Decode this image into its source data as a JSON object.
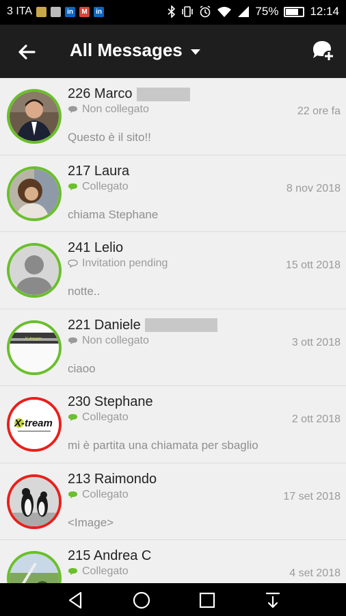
{
  "status_bar": {
    "carrier": "3 ITA",
    "battery": "75%",
    "battery_level": 0.75,
    "time": "12:14"
  },
  "app_bar": {
    "title": "All Messages"
  },
  "conversations": [
    {
      "name": "226 Marco",
      "status": "Non collegato",
      "date": "22 ore fa",
      "message": "Questo è il sito!!",
      "online": false,
      "avatar": "marco-photo",
      "ring": "#6abf2b"
    },
    {
      "name": "217 Laura",
      "status": "Collegato",
      "date": "8 nov 2018",
      "message": "chiama Stephane",
      "online": true,
      "avatar": "laura-photo",
      "ring": "#6abf2b"
    },
    {
      "name": "241 Lelio",
      "status": "Invitation pending",
      "date": "15 ott 2018",
      "message": "notte..",
      "online": false,
      "avatar": "default-person",
      "ring": "#6abf2b"
    },
    {
      "name": "221 Daniele",
      "status": "Non collegato",
      "date": "3 ott 2018",
      "message": "ciaoo",
      "online": false,
      "avatar": "daniele-photo",
      "ring": "#6abf2b"
    },
    {
      "name": "230 Stephane",
      "status": "Collegato",
      "date": "2 ott 2018",
      "message": "mi è partita una chiamata per sbaglio",
      "online": true,
      "avatar": "xtream-logo",
      "ring": "#e8201b"
    },
    {
      "name": "213 Raimondo",
      "status": "Collegato",
      "date": "17 set 2018",
      "message": "<Image>",
      "online": true,
      "avatar": "penguins-photo",
      "ring": "#e8201b"
    },
    {
      "name": "215 Andrea C",
      "status": "Collegato",
      "date": "4 set 2018",
      "message": "",
      "online": true,
      "avatar": "golf-photo",
      "ring": "#6abf2b"
    }
  ],
  "colors": {
    "online": "#6abf2b",
    "offline": "#9a9a9a",
    "ring_green": "#6abf2b",
    "ring_red": "#e8201b"
  }
}
